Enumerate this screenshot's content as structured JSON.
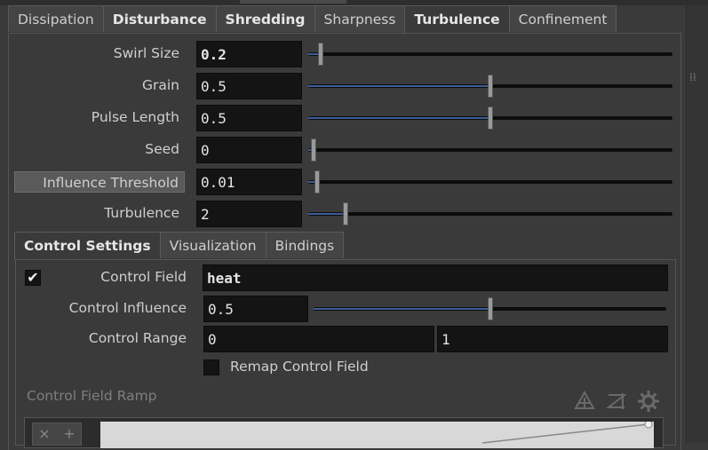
{
  "tabs_top": [
    {
      "label": "Dissipation",
      "bold": false,
      "active": false
    },
    {
      "label": "Disturbance",
      "bold": true,
      "active": false
    },
    {
      "label": "Shredding",
      "bold": true,
      "active": false
    },
    {
      "label": "Sharpness",
      "bold": false,
      "active": false
    },
    {
      "label": "Turbulence",
      "bold": true,
      "active": true
    },
    {
      "label": "Confinement",
      "bold": false,
      "active": false
    }
  ],
  "turbulence": {
    "swirl_size": {
      "label": "Swirl Size",
      "value": "0.2",
      "level": 0.02
    },
    "grain": {
      "label": "Grain",
      "value": "0.5",
      "level": 0.5
    },
    "pulse_length": {
      "label": "Pulse Length",
      "value": "0.5",
      "level": 0.5
    },
    "seed": {
      "label": "Seed",
      "value": "0",
      "level": 0.0
    },
    "influence_threshold": {
      "label": "Influence Threshold",
      "value": "0.01",
      "level": 0.01
    },
    "turbulence": {
      "label": "Turbulence",
      "value": "2",
      "level": 0.09
    }
  },
  "tabs_control": [
    {
      "label": "Control Settings",
      "bold": true,
      "active": true
    },
    {
      "label": "Visualization",
      "bold": false,
      "active": false
    },
    {
      "label": "Bindings",
      "bold": false,
      "active": false
    }
  ],
  "control": {
    "field": {
      "label": "Control Field",
      "value": "heat",
      "checked": true,
      "check_glyph": "✔"
    },
    "influence": {
      "label": "Control Influence",
      "value": "0.5",
      "level": 0.5
    },
    "range": {
      "label": "Control Range",
      "min": "0",
      "max": "1"
    },
    "remap": {
      "label": "Remap Control Field",
      "checked": false
    },
    "ramp": {
      "label": "Control Field Ramp"
    }
  },
  "ramp_buttons": {
    "remove": "×",
    "add": "+"
  },
  "colors": {
    "accent": "#3c5f9c",
    "field_bg": "#141414",
    "panel_bg": "#3a3a3a"
  }
}
